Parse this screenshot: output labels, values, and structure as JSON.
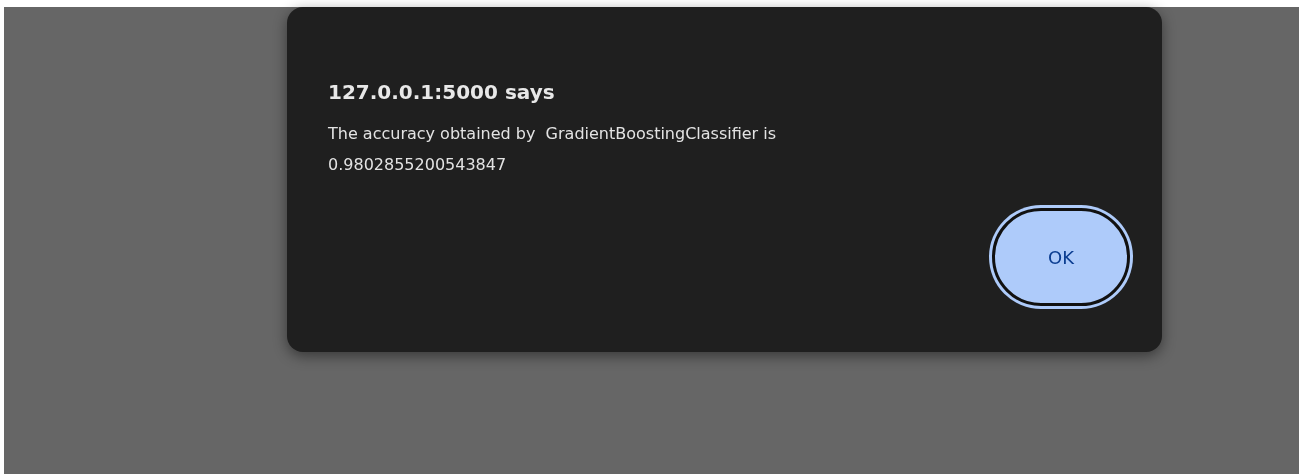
{
  "dialog": {
    "title": "127.0.0.1:5000 says",
    "message": "The accuracy obtained by  GradientBoostingClassifier is\n0.9802855200543847",
    "buttons": [
      {
        "label": "OK",
        "focused": true
      }
    ]
  }
}
